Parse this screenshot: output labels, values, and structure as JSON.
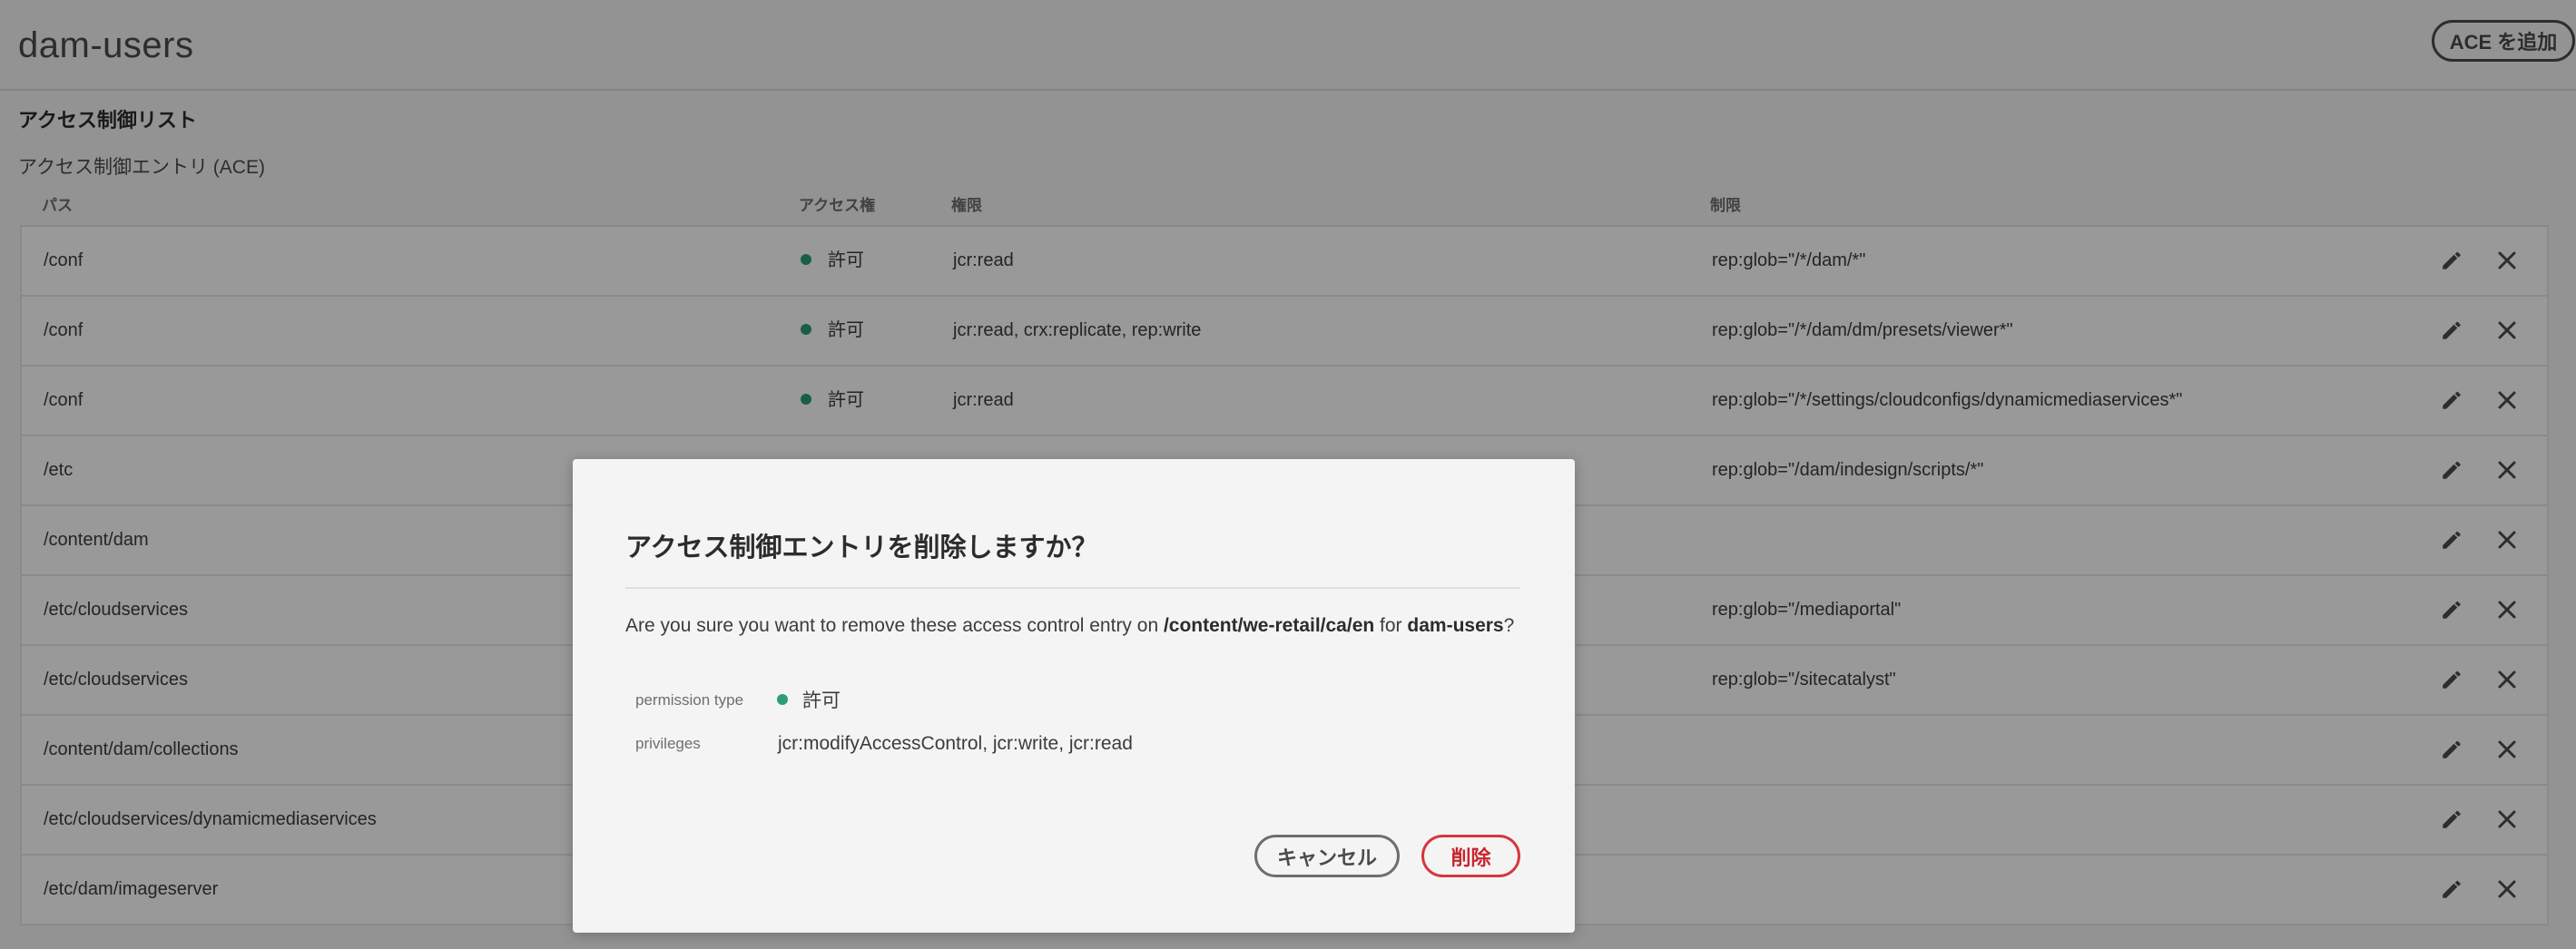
{
  "header": {
    "title": "dam-users",
    "add_ace_label": "ACE を追加"
  },
  "acl": {
    "heading": "アクセス制御リスト",
    "ace_heading": "アクセス制御エントリ (ACE)",
    "columns": {
      "path": "パス",
      "permission": "アクセス権",
      "privileges": "権限",
      "restrictions": "制限"
    },
    "rows": [
      {
        "path": "/conf",
        "permission": "許可",
        "privileges": "jcr:read",
        "restrictions": "rep:glob=\"/*/dam/*\""
      },
      {
        "path": "/conf",
        "permission": "許可",
        "privileges": "jcr:read, crx:replicate, rep:write",
        "restrictions": "rep:glob=\"/*/dam/dm/presets/viewer*\""
      },
      {
        "path": "/conf",
        "permission": "許可",
        "privileges": "jcr:read",
        "restrictions": "rep:glob=\"/*/settings/cloudconfigs/dynamicmediaservices*\""
      },
      {
        "path": "/etc",
        "permission": "",
        "privileges": "",
        "restrictions": "rep:glob=\"/dam/indesign/scripts/*\""
      },
      {
        "path": "/content/dam",
        "permission": "",
        "privileges": "",
        "restrictions": ""
      },
      {
        "path": "/etc/cloudservices",
        "permission": "",
        "privileges": "",
        "restrictions": "rep:glob=\"/mediaportal\""
      },
      {
        "path": "/etc/cloudservices",
        "permission": "",
        "privileges": "",
        "restrictions": "rep:glob=\"/sitecatalyst\""
      },
      {
        "path": "/content/dam/collections",
        "permission": "",
        "privileges": "",
        "restrictions": ""
      },
      {
        "path": "/etc/cloudservices/dynamicmediaservices",
        "permission": "",
        "privileges": "",
        "restrictions": ""
      },
      {
        "path": "/etc/dam/imageserver",
        "permission": "",
        "privileges": "",
        "restrictions": ""
      }
    ]
  },
  "dialog": {
    "title": "アクセス制御エントリを削除しますか？",
    "message_prefix": "Are you sure you want to remove these access control entry on ",
    "message_path": "/content/we-retail/ca/en",
    "message_mid": " for ",
    "message_user": "dam-users",
    "message_suffix": "?",
    "permission_type_label": "permission type",
    "permission_type_value": "許可",
    "privileges_label": "privileges",
    "privileges_value": "jcr:modifyAccessControl, jcr:write, jcr:read",
    "cancel_label": "キャンセル",
    "delete_label": "削除"
  },
  "colors": {
    "allow_dot": "#2d9d78",
    "delete_accent": "#d7373f"
  },
  "icons": {
    "edit": "pencil-icon",
    "remove": "close-icon"
  }
}
